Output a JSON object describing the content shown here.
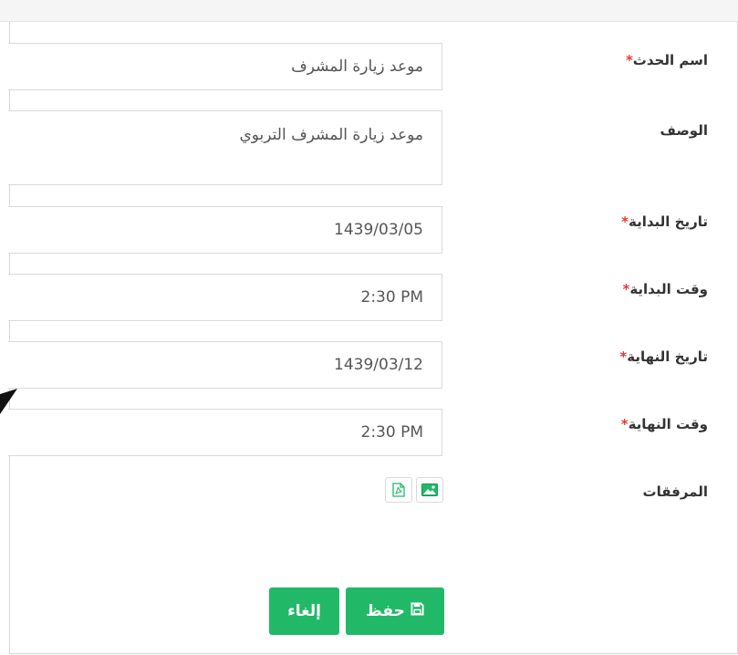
{
  "form": {
    "event_name": {
      "label": "اسم الحدث",
      "required_mark": "*",
      "value": "موعد زيارة المشرف"
    },
    "description": {
      "label": "الوصف",
      "value": "موعد زيارة المشرف التربوي"
    },
    "start_date": {
      "label": "تاريخ البداية",
      "required_mark": "*",
      "value": "1439/03/05"
    },
    "start_time": {
      "label": "وقت البداية",
      "required_mark": "*",
      "value": "2:30 PM"
    },
    "end_date": {
      "label": "تاريخ النهاية",
      "required_mark": "*",
      "value": "1439/03/12"
    },
    "end_time": {
      "label": "وقت النهاية",
      "required_mark": "*",
      "value": "2:30 PM"
    },
    "attachments": {
      "label": "المرفقات",
      "icons": [
        "image-icon",
        "pdf-icon"
      ]
    }
  },
  "actions": {
    "save_label": "حفظ",
    "cancel_label": "إلغاء"
  },
  "colors": {
    "accent": "#21b968",
    "required": "#e53935"
  }
}
